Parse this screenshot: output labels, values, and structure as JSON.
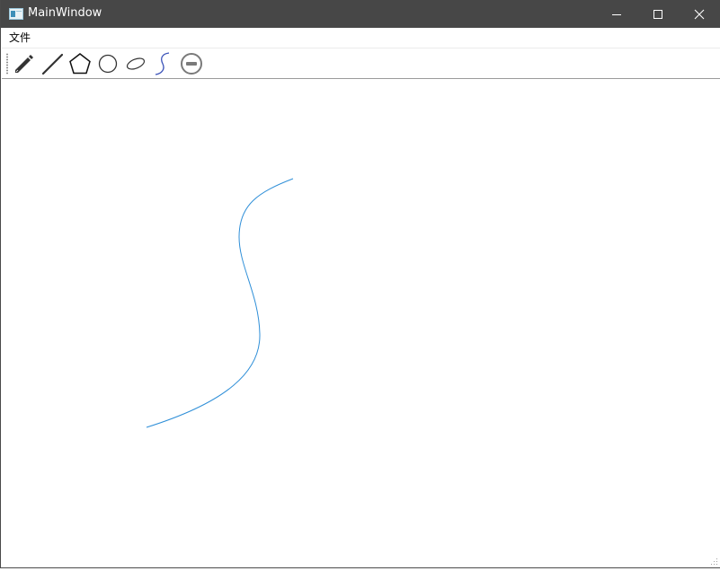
{
  "window": {
    "title": "MainWindow",
    "controls": {
      "minimize": "minimize",
      "maximize": "maximize",
      "close": "close"
    }
  },
  "menubar": {
    "items": [
      {
        "label": "文件"
      }
    ]
  },
  "toolbar": {
    "tools": [
      {
        "name": "pencil-icon"
      },
      {
        "name": "line-icon"
      },
      {
        "name": "pentagon-icon"
      },
      {
        "name": "circle-icon"
      },
      {
        "name": "ellipse-icon"
      },
      {
        "name": "curve-icon"
      },
      {
        "name": "eraser-icon"
      }
    ]
  },
  "canvas": {
    "stroke_color": "#2f8fd8",
    "drawn_shape": "bezier-curve"
  },
  "colors": {
    "titlebar": "#474747",
    "title_text": "#ffffff",
    "canvas_bg": "#ffffff"
  }
}
